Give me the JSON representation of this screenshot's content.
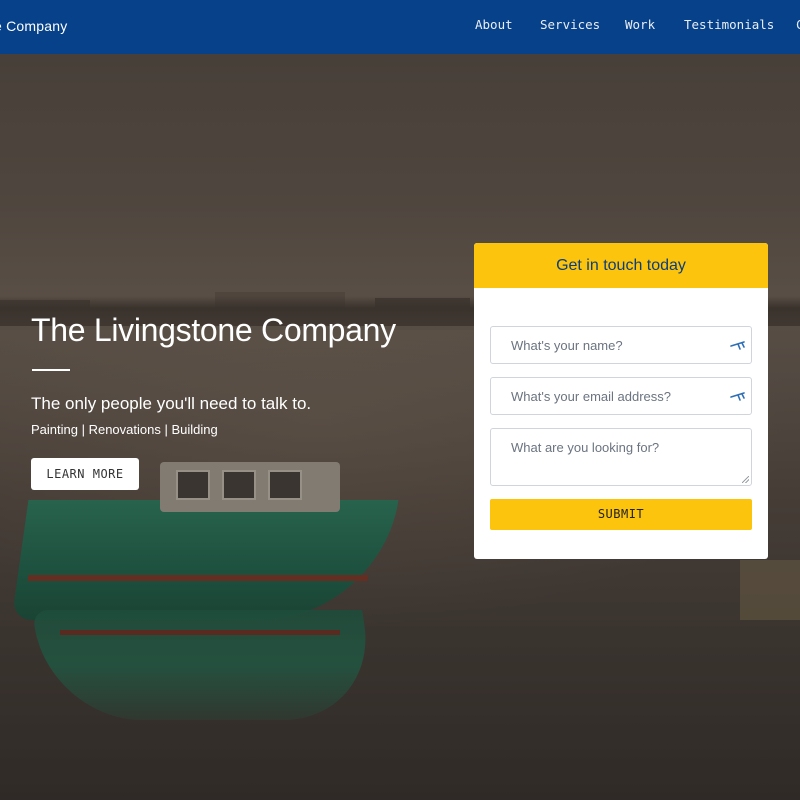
{
  "navbar": {
    "brand": "e Company",
    "items": [
      {
        "label": "About"
      },
      {
        "label": "Services"
      },
      {
        "label": "Work"
      },
      {
        "label": "Testimonials"
      },
      {
        "label": "C"
      }
    ]
  },
  "hero": {
    "title": "The Livingstone Company",
    "tagline": "The only people you'll need to talk to.",
    "services": "Painting | Renovations | Building",
    "cta_label": "LEARN MORE"
  },
  "contact_form": {
    "heading": "Get in touch today",
    "name_placeholder": "What's your name?",
    "email_placeholder": "What's your email address?",
    "message_placeholder": "What are you looking for?",
    "submit_label": "SUBMIT",
    "field_icon": "autofill-key-icon"
  },
  "colors": {
    "nav_background": "#06418a",
    "accent_yellow": "#fdc40e",
    "heading_blue": "#0d3d7a"
  }
}
